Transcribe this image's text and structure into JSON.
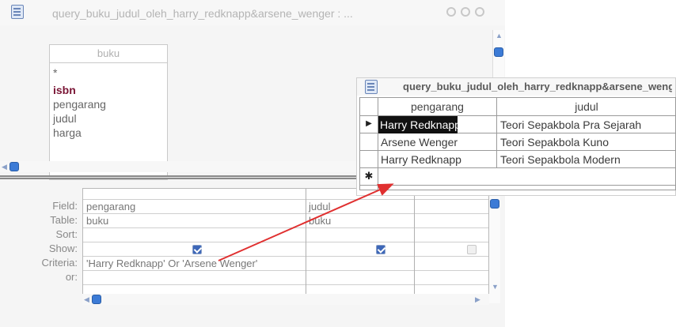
{
  "design_window": {
    "title": "query_buku_judul_oleh_harry_redknapp&arsene_wenger : ..."
  },
  "table_box": {
    "name": "buku",
    "fields": [
      "*",
      "isbn",
      "pengarang",
      "judul",
      "harga"
    ]
  },
  "grid": {
    "row_labels": [
      "Field:",
      "Table:",
      "Sort:",
      "Show:",
      "Criteria:",
      "or:"
    ],
    "columns": [
      {
        "field": "pengarang",
        "table": "buku",
        "show": true
      },
      {
        "field": "judul",
        "table": "buku",
        "show": true
      },
      {
        "field": "",
        "table": "",
        "show": false
      }
    ],
    "criteria": "'Harry Redknapp' Or 'Arsene Wenger'"
  },
  "result_window": {
    "title": "query_buku_judul_oleh_harry_redknapp&arsene_wenger",
    "headers": [
      "pengarang",
      "judul"
    ],
    "rows": [
      {
        "pengarang": "Harry Redknapp",
        "judul": "Teori Sepakbola Pra Sejarah"
      },
      {
        "pengarang": "Arsene Wenger",
        "judul": "Teori Sepakbola Kuno"
      },
      {
        "pengarang": "Harry Redknapp",
        "judul": "Teori Sepakbola Modern"
      }
    ],
    "current_row_marker": "▶",
    "new_row_marker": "✱"
  },
  "colors": {
    "annotation_arrow": "#e03030",
    "scroll_thumb": "#3c7bd6",
    "key_field": "#7a1535"
  }
}
